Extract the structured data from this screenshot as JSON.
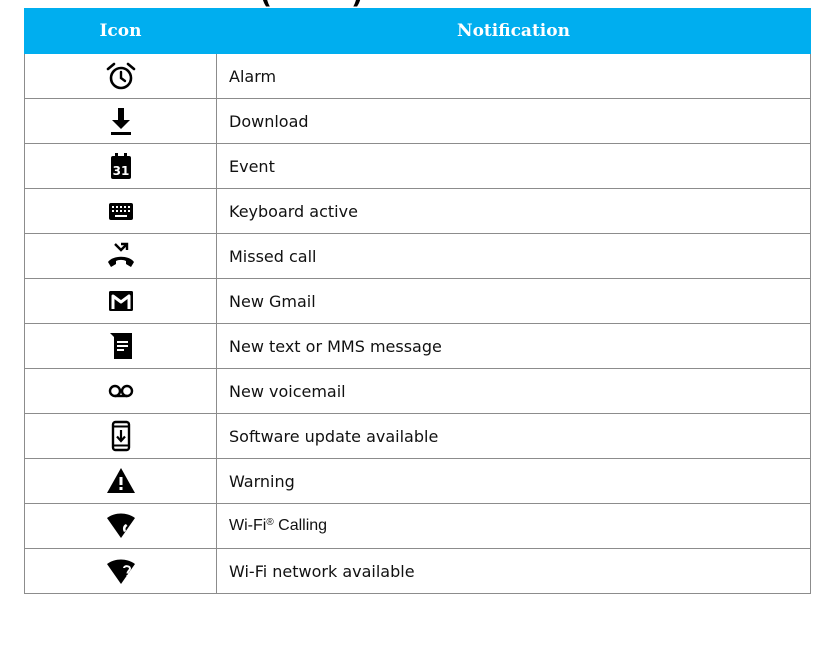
{
  "heading_fragment": "(",
  "table": {
    "headers": {
      "icon": "Icon",
      "notification": "Notification"
    },
    "header_color": "#00aeef",
    "rows": [
      {
        "icon": "alarm-icon",
        "label": "Alarm"
      },
      {
        "icon": "download-icon",
        "label": "Download"
      },
      {
        "icon": "calendar-event-icon",
        "icon_text": "31",
        "label": "Event"
      },
      {
        "icon": "keyboard-icon",
        "label": "Keyboard active"
      },
      {
        "icon": "missed-call-icon",
        "label": "Missed call"
      },
      {
        "icon": "gmail-icon",
        "label": "New Gmail"
      },
      {
        "icon": "message-icon",
        "label": "New text or MMS message"
      },
      {
        "icon": "voicemail-icon",
        "label": "New voicemail"
      },
      {
        "icon": "software-update-icon",
        "label": "Software update available"
      },
      {
        "icon": "warning-icon",
        "label": "Warning"
      },
      {
        "icon": "wifi-calling-icon",
        "label_prefix": "Wi-Fi",
        "label_reg": "®",
        "label_suffix": " Calling"
      },
      {
        "icon": "wifi-network-available-icon",
        "label": "Wi-Fi network available"
      }
    ]
  }
}
